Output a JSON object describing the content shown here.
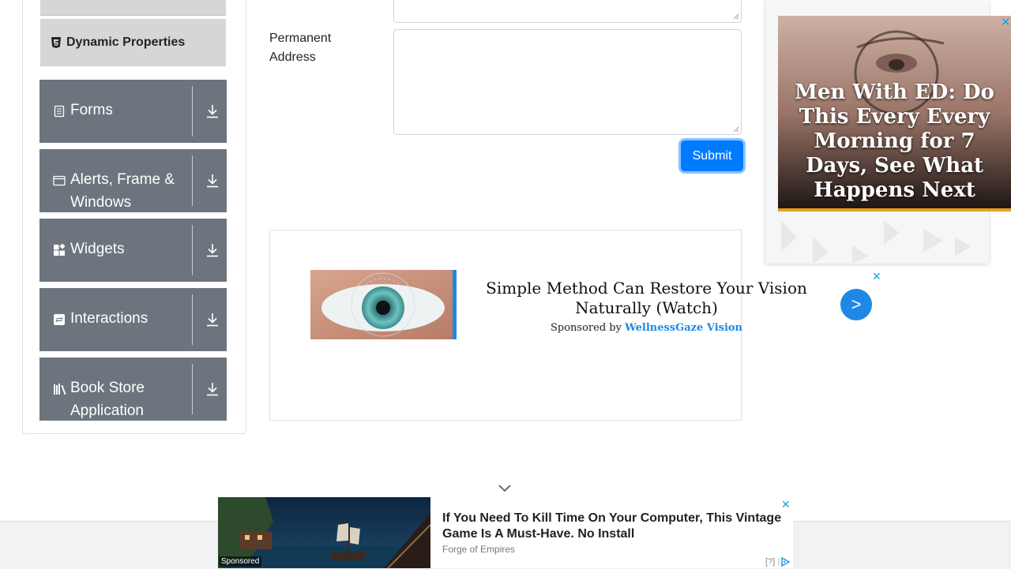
{
  "sidebar": {
    "subitem_label": "Dynamic Properties",
    "groups": [
      {
        "label": "Forms",
        "icon": "form-icon"
      },
      {
        "label": "Alerts, Frame & Windows",
        "icon": "window-icon"
      },
      {
        "label": "Widgets",
        "icon": "widgets-icon"
      },
      {
        "label": "Interactions",
        "icon": "interactions-icon"
      },
      {
        "label": "Book Store Application",
        "icon": "books-icon"
      }
    ]
  },
  "form": {
    "permanent_address_label": "Permanent Address",
    "permanent_address_value": "",
    "current_address_value": "",
    "submit_label": "Submit"
  },
  "middle_ad": {
    "title": "Simple Method Can Restore Your Vision Naturally (Watch)",
    "sponsored_prefix": "Sponsored by",
    "brand": "WellnessGaze Vision",
    "close": "✕",
    "arrow": ">"
  },
  "right_ad": {
    "headline": "Men With ED: Do This Every Every Morning for 7 Days, See What Happens Next",
    "close": "✕"
  },
  "bottom_ad": {
    "title": "If You Need To Kill Time On Your Computer, This Vintage Game Is A Must-Have. No Install",
    "source": "Forge of Empires",
    "sponsored": "Sponsored",
    "info": "[?]",
    "close": "✕"
  },
  "colors": {
    "accent": "#007bff",
    "group_bg": "#6c757d",
    "subitem_bg": "#d6d6d6",
    "ad_link": "#1e88e5"
  }
}
